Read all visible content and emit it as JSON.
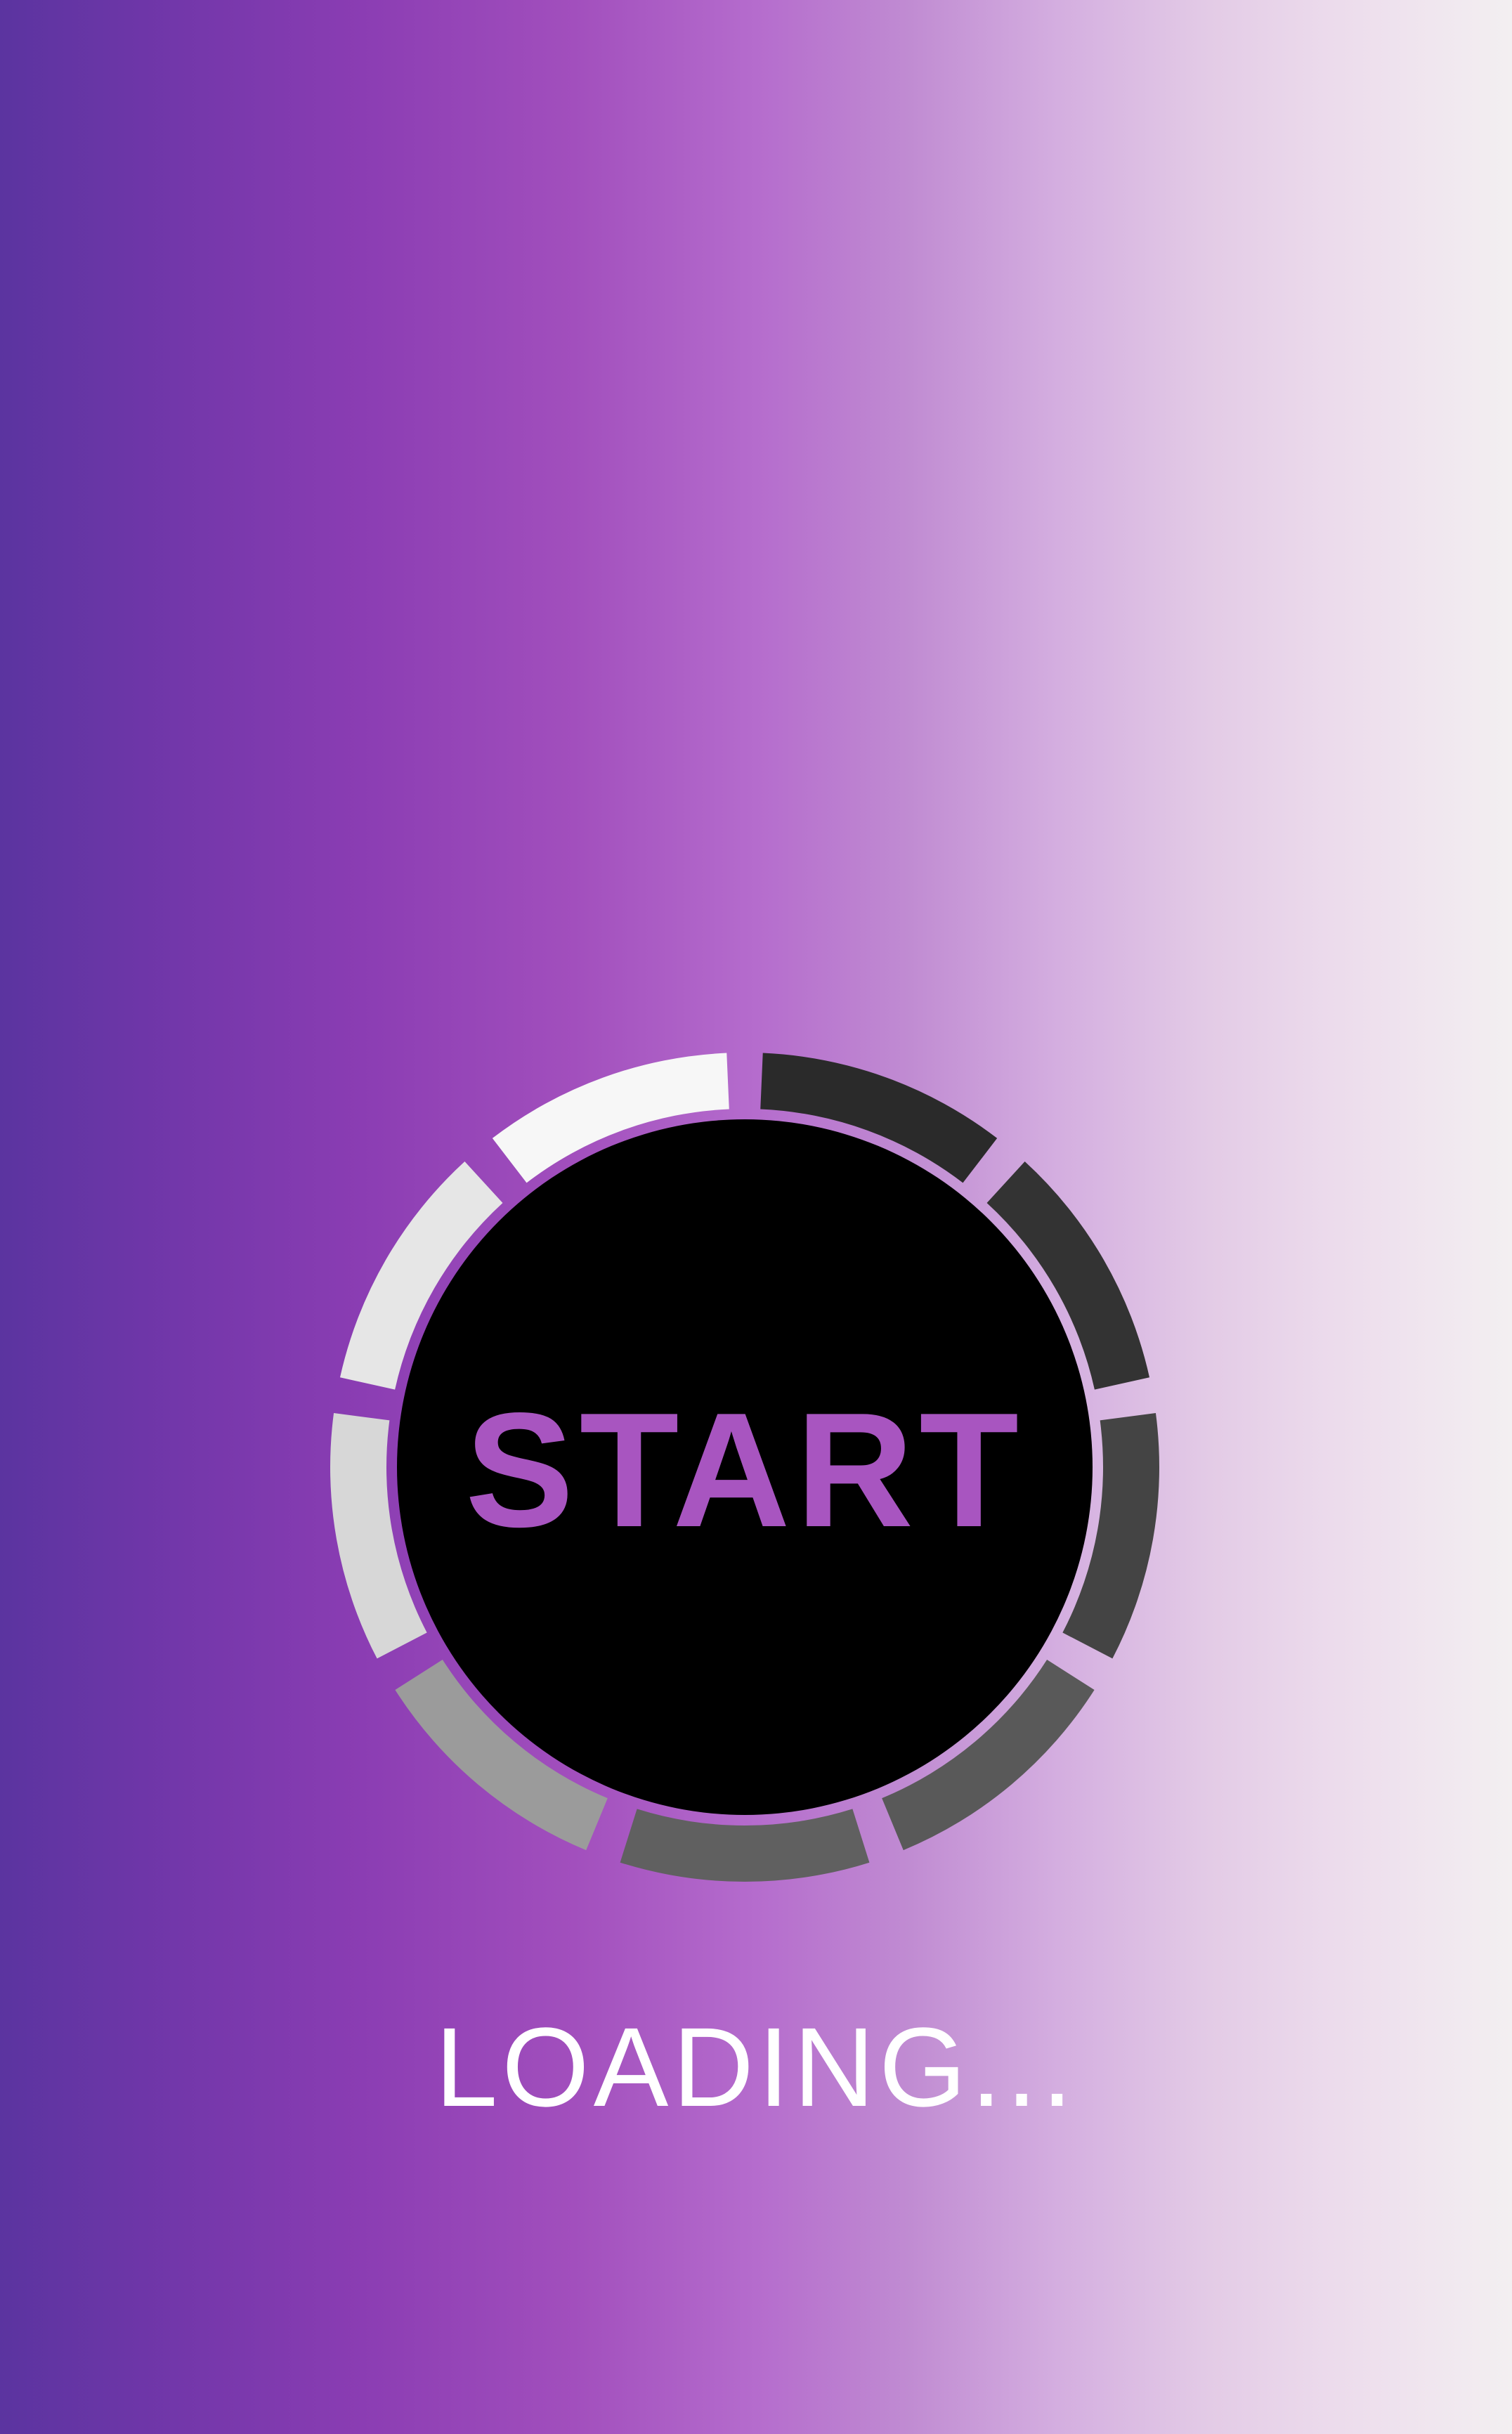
{
  "start_button": {
    "label": "START",
    "label_color": "#a855c0",
    "disc_color": "#000000",
    "progress_segments": [
      "#2a2a2a",
      "#333333",
      "#444444",
      "#595959",
      "#606060",
      "#9b9b9b",
      "#d7d7d7",
      "#e6e6e6",
      "#f7f7f7"
    ]
  },
  "status": {
    "loading_text": "LOADING..."
  }
}
